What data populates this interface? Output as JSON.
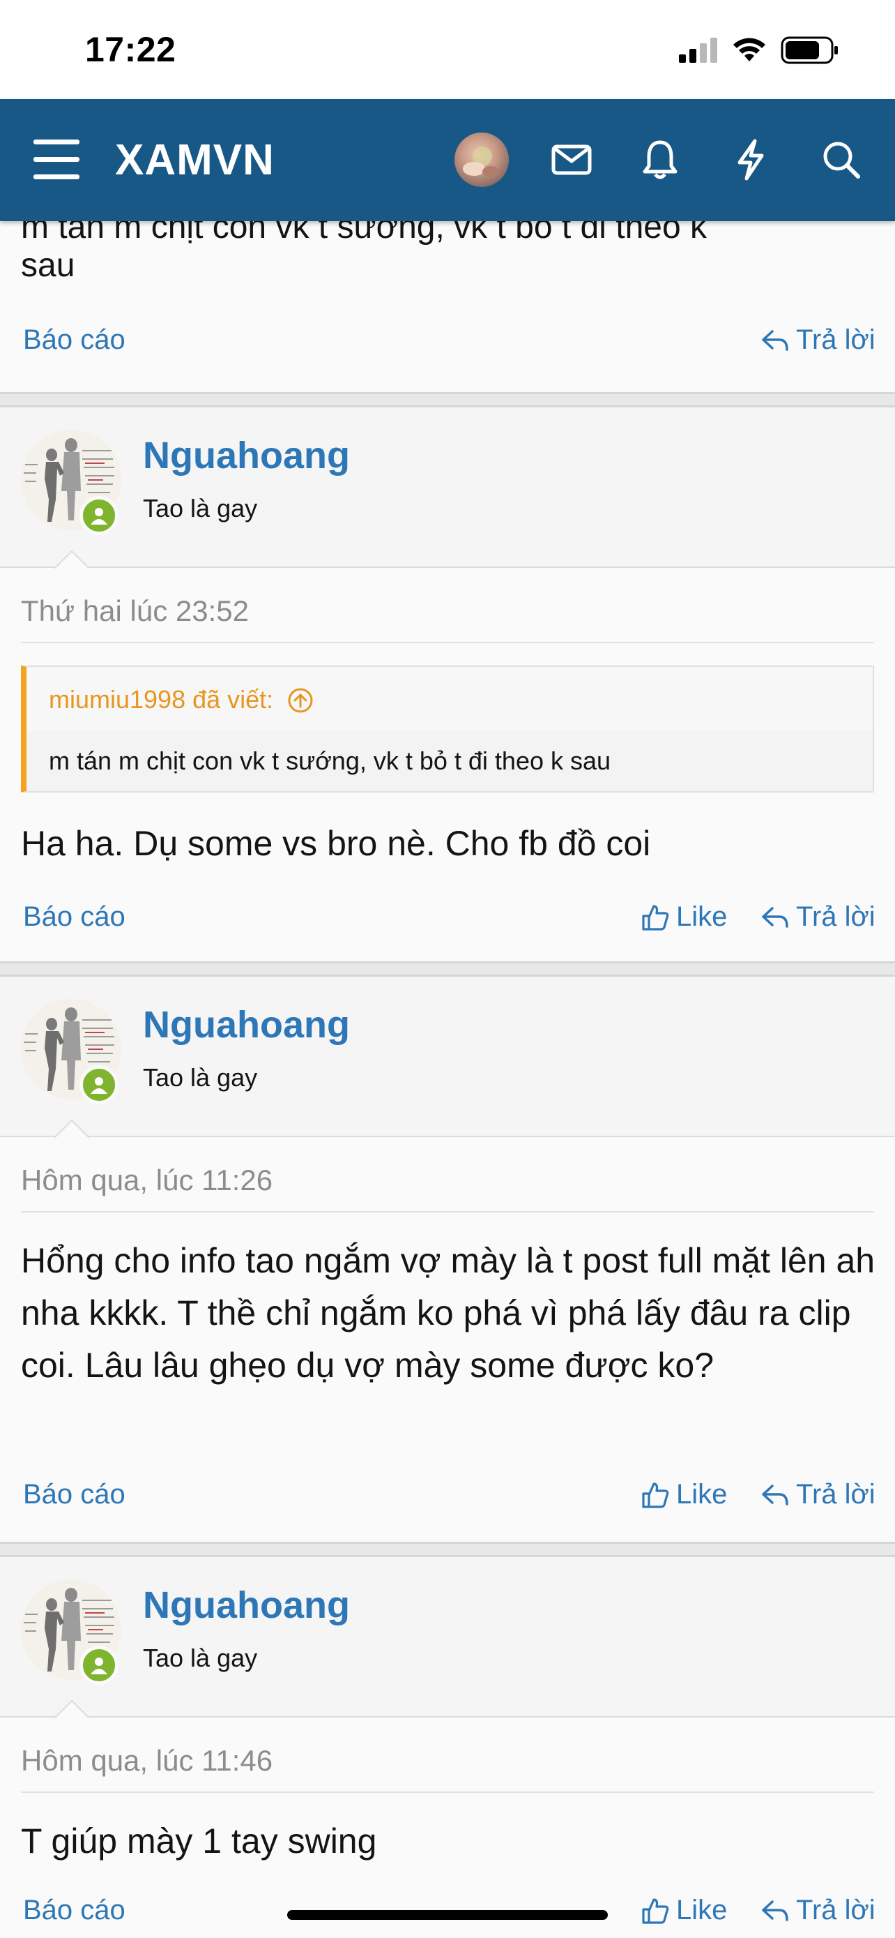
{
  "status": {
    "time": "17:22"
  },
  "header": {
    "logo": "XAMVN"
  },
  "cut_post": {
    "text_line1": "m tán m chịt con vk t sướng, vk t bỏ t đi theo k",
    "text_line2": "sau",
    "report": "Báo cáo",
    "reply": "Trả lời"
  },
  "posts": [
    {
      "username": "Nguahoang",
      "usertitle": "Tao là gay",
      "date": "Thứ hai lúc 23:52",
      "quote_author": "miumiu1998 đã viết:",
      "quote_text": "m tán m chịt con vk t sướng, vk t bỏ t đi theo k sau",
      "body": "Ha ha. Dụ some vs bro nè. Cho fb đồ coi",
      "report": "Báo cáo",
      "like": "Like",
      "reply": "Trả lời"
    },
    {
      "username": "Nguahoang",
      "usertitle": "Tao là gay",
      "date": "Hôm qua, lúc 11:26",
      "body": "Hổng cho info tao ngắm vợ mày là t post full mặt lên ah nha kkkk. T thề chỉ ngắm ko phá vì phá lấy đâu ra clip coi. Lâu lâu ghẹo dụ vợ mày some được ko?",
      "report": "Báo cáo",
      "like": "Like",
      "reply": "Trả lời"
    },
    {
      "username": "Nguahoang",
      "usertitle": "Tao là gay",
      "date": "Hôm qua, lúc 11:46",
      "body": "T giúp mày 1 tay swing",
      "report": "Báo cáo",
      "like": "Like",
      "reply": "Trả lời"
    }
  ],
  "colors": {
    "header_bg": "#185886",
    "link": "#2e77b6",
    "quote_accent": "#f4a21f",
    "online": "#7fb52e"
  }
}
